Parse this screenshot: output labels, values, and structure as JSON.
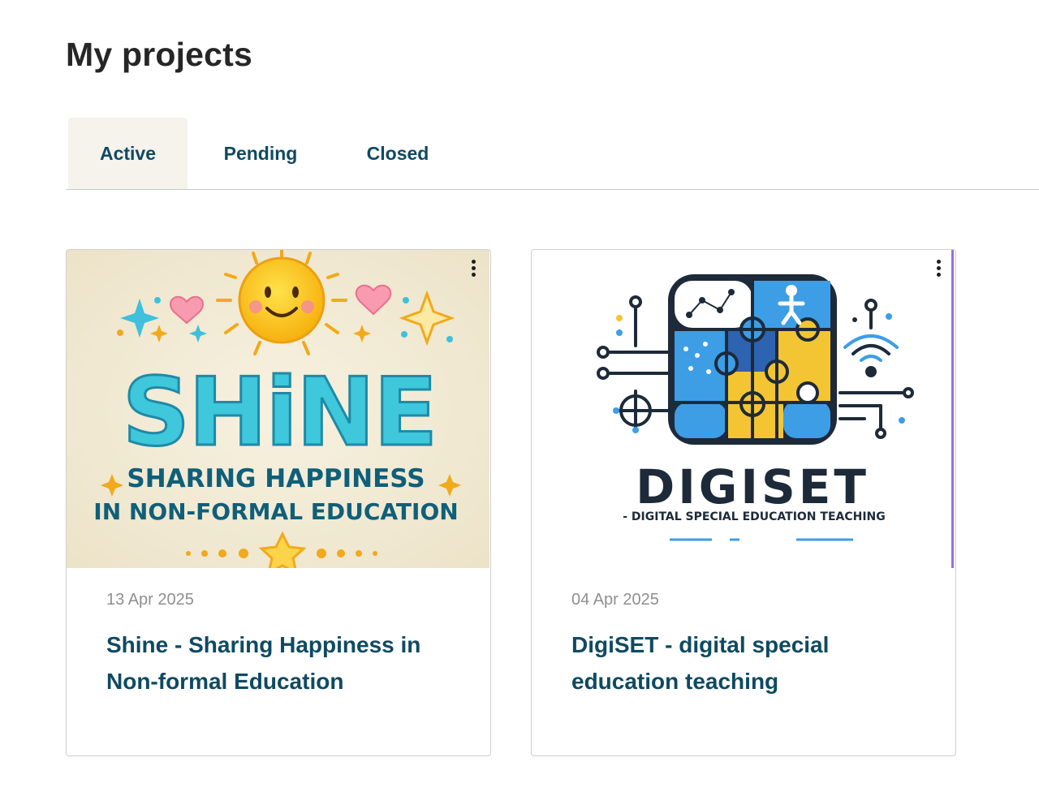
{
  "header": {
    "title": "My projects"
  },
  "tabs": [
    {
      "label": "Active",
      "active": true
    },
    {
      "label": "Pending",
      "active": false
    },
    {
      "label": "Closed",
      "active": false
    }
  ],
  "projects": [
    {
      "date": "13 Apr 2025",
      "title": "Shine - Sharing Happiness in Non-formal Education",
      "image": {
        "big_text": "SHiNE",
        "line1": "SHARING HAPPINESS",
        "line2": "IN NON-FORMAL EDUCATION"
      }
    },
    {
      "date": "04 Apr 2025",
      "title": "DigiSET - digital special education teaching",
      "image": {
        "big_text": "DIGISET",
        "subtitle": "- DIGITAL SPECIAL EDUCATION TEACHING"
      }
    }
  ],
  "colors": {
    "accent_text": "#0e4a62",
    "active_tab_bg": "#f6f2ec",
    "date_text": "#8f8f8f"
  },
  "icons": [
    "more-vertical-icon"
  ]
}
